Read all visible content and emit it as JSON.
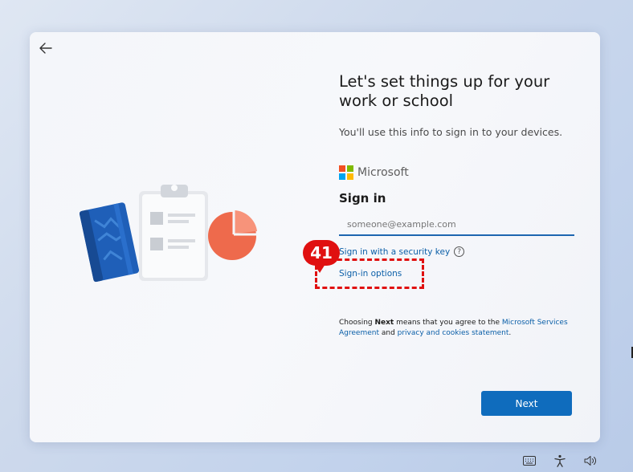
{
  "page": {
    "title": "Let's set things up for your work or school",
    "subtitle": "You'll use this info to sign in to your devices."
  },
  "brand": {
    "name": "Microsoft",
    "logo_colors": [
      "#f25022",
      "#7fba00",
      "#00a4ef",
      "#ffb900"
    ]
  },
  "signin": {
    "heading": "Sign in",
    "email_placeholder": "someone@example.com",
    "email_value": "",
    "security_key_link": "Sign in with a security key",
    "options_link": "Sign-in options"
  },
  "terms": {
    "prefix": "Choosing ",
    "bold": "Next",
    "middle": " means that you agree to the ",
    "link1": "Microsoft Services Agreement",
    "and": " and ",
    "link2": "privacy and cookies statement",
    "suffix": "."
  },
  "actions": {
    "next_label": "Next"
  },
  "annotation": {
    "step_number": "41",
    "color": "#e01010"
  },
  "colors": {
    "accent": "#0f6cbd",
    "link": "#0b5fa8"
  },
  "icons": {
    "back": "back-arrow-icon",
    "help": "question-circle-icon",
    "taskbar": [
      "keyboard-icon",
      "accessibility-icon",
      "volume-icon"
    ]
  }
}
